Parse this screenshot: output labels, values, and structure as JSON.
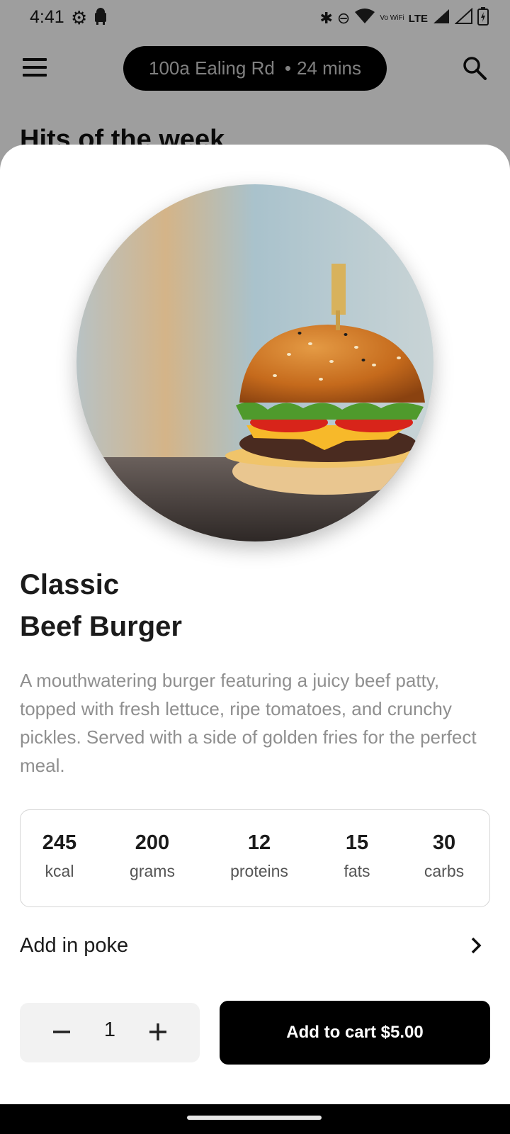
{
  "status_bar": {
    "time": "4:41",
    "network": "LTE",
    "wifi_label": "Vo WiFi"
  },
  "header": {
    "location": "100a Ealing Rd",
    "eta": "24 mins"
  },
  "background": {
    "section_heading": "Hits of the week"
  },
  "dish": {
    "title_line1": "Classic",
    "title_line2": "Beef Burger",
    "description": "A mouthwatering burger featuring a juicy beef patty, topped with fresh lettuce, ripe tomatoes, and crunchy pickles. Served with a side of golden fries for the perfect meal."
  },
  "nutrition": [
    {
      "value": "245",
      "unit": "kcal"
    },
    {
      "value": "200",
      "unit": "grams"
    },
    {
      "value": "12",
      "unit": "proteins"
    },
    {
      "value": "15",
      "unit": "fats"
    },
    {
      "value": "30",
      "unit": "carbs"
    }
  ],
  "addon": {
    "label": "Add in poke"
  },
  "order": {
    "quantity": "1",
    "cart_label": "Add to cart $5.00"
  },
  "colors": {
    "accent": "#000000",
    "muted_text": "#8f8f8f",
    "border": "#d6d6d6"
  }
}
